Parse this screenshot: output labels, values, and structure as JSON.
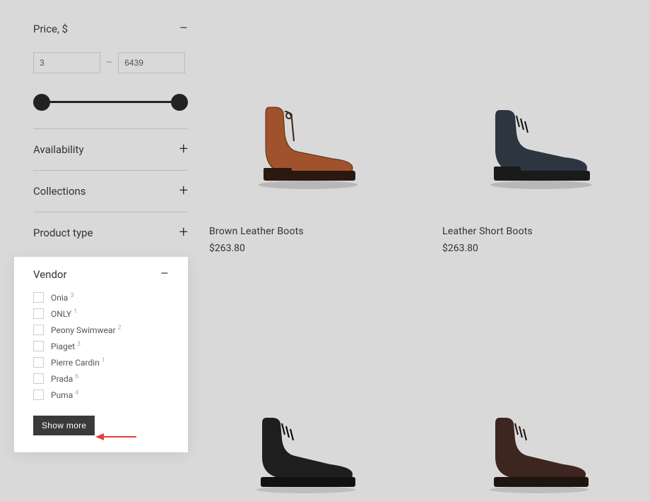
{
  "filters": {
    "price": {
      "label": "Price, $",
      "min": "3",
      "max": "6439",
      "sep": "–"
    },
    "availability": {
      "label": "Availability"
    },
    "collections": {
      "label": "Collections"
    },
    "product_type": {
      "label": "Product type"
    },
    "vendor": {
      "label": "Vendor",
      "items": [
        {
          "name": "Onia",
          "count": "3"
        },
        {
          "name": "ONLY",
          "count": "1"
        },
        {
          "name": "Peony Swimwear",
          "count": "2"
        },
        {
          "name": "Piaget",
          "count": "3"
        },
        {
          "name": "Pierre Cardin",
          "count": "1"
        },
        {
          "name": "Prada",
          "count": "6"
        },
        {
          "name": "Puma",
          "count": "4"
        }
      ],
      "show_more": "Show more"
    }
  },
  "products": [
    {
      "name": "Brown Leather Boots",
      "price": "$263.80"
    },
    {
      "name": "Leather Short Boots",
      "price": "$263.80"
    },
    {
      "name": "",
      "price": ""
    },
    {
      "name": "",
      "price": ""
    }
  ],
  "ui_colors": {
    "page_bg": "#d9d9d9",
    "panel_bg": "#ffffff",
    "text": "#333333",
    "btn_bg": "#3a3a3a",
    "arrow": "#e53e3e"
  }
}
